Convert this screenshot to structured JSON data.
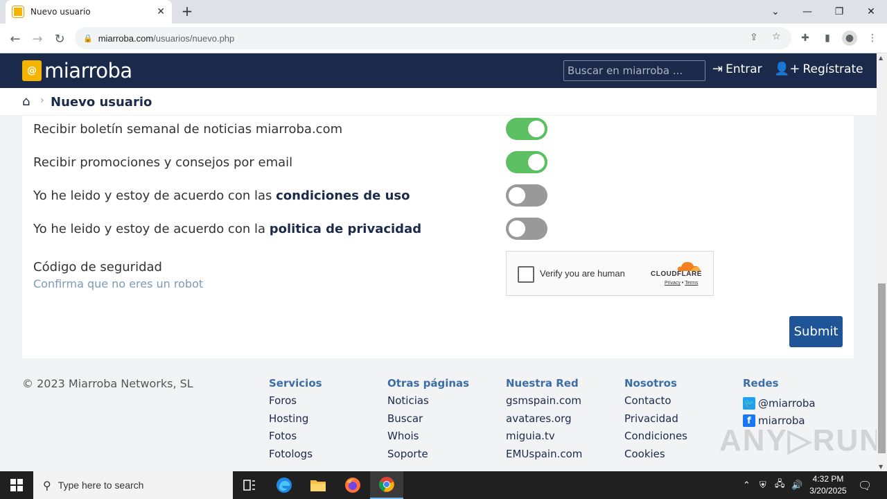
{
  "browser": {
    "tab_title": "Nuevo usuario",
    "url_host": "miarroba.com",
    "url_path": "/usuarios/nuevo.php"
  },
  "site": {
    "logo_text": "miarroba",
    "logo_mark": "@",
    "search_placeholder": "Buscar en miarroba ...",
    "login_label": "Entrar",
    "register_label": "Regístrate"
  },
  "breadcrumb": {
    "title": "Nuevo usuario"
  },
  "form": {
    "rows": [
      {
        "label": "Recibir boletín semanal de noticias miarroba.com",
        "bold": "",
        "on": true
      },
      {
        "label": "Recibir promociones y consejos por email",
        "bold": "",
        "on": true
      },
      {
        "label": "Yo he leido y estoy de acuerdo con las ",
        "bold": "condiciones de uso",
        "on": false
      },
      {
        "label": "Yo he leido y estoy de acuerdo con la ",
        "bold": "politica de privacidad",
        "on": false
      }
    ],
    "security_label": "Código de seguridad",
    "security_sub": "Confirma que no eres un robot",
    "captcha": {
      "verify_text": "Verify you are human",
      "brand": "CLOUDFLARE",
      "privacy": "Privacy",
      "sep": " • ",
      "terms": "Terms"
    },
    "submit_label": "Submit"
  },
  "footer": {
    "copyright": "© 2023 Miarroba Networks, SL",
    "columns": [
      {
        "head": "Servicios",
        "items": [
          "Foros",
          "Hosting",
          "Fotos",
          "Fotologs"
        ]
      },
      {
        "head": "Otras páginas",
        "items": [
          "Noticias",
          "Buscar",
          "Whois",
          "Soporte"
        ]
      },
      {
        "head": "Nuestra Red",
        "items": [
          "gsmspain.com",
          "avatares.org",
          "miguia.tv",
          "EMUspain.com"
        ]
      },
      {
        "head": "Nosotros",
        "items": [
          "Contacto",
          "Privacidad",
          "Condiciones",
          "Cookies"
        ]
      },
      {
        "head": "Redes",
        "items": [
          "@miarroba",
          "miarroba"
        ]
      }
    ],
    "watermark": "ANY▷RUN"
  },
  "taskbar": {
    "search_placeholder": "Type here to search",
    "time": "4:32 PM",
    "date": "3/20/2025"
  },
  "colors": {
    "header_bg": "#1b2a4a",
    "toggle_on": "#5cbf62",
    "toggle_off": "#999999",
    "submit_bg": "#1f5596",
    "footer_head": "#3b6ea5"
  }
}
